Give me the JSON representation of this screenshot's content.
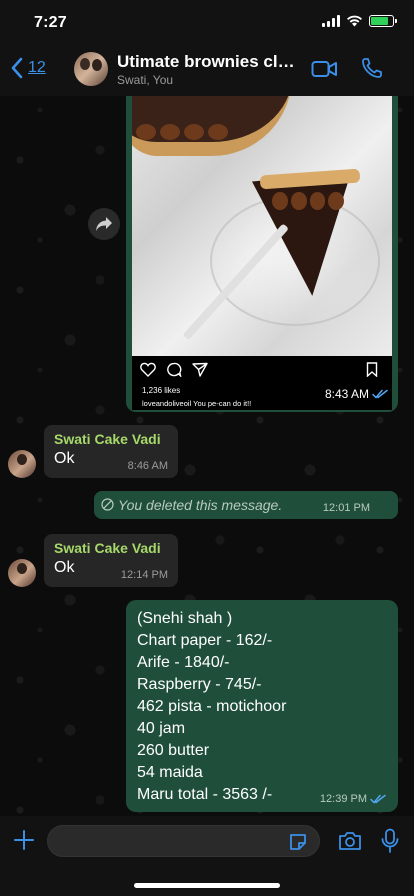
{
  "status_bar": {
    "time": "7:27",
    "battery_level": 0.8
  },
  "header": {
    "back_count": "12",
    "title": "Utimate brownies clas...",
    "subtitle": "Swati, You",
    "video_icon": "video-call-icon",
    "phone_icon": "phone-icon"
  },
  "image_message": {
    "likes": "1,236 likes",
    "caption": "loveandoliveoil You pe-can do it!!",
    "time": "8:43 AM"
  },
  "messages": [
    {
      "sender": "Swati Cake Vadi",
      "text": "Ok",
      "time": "8:46 AM"
    },
    {
      "sender": "Swati Cake Vadi",
      "text": "Ok",
      "time": "12:14 PM"
    }
  ],
  "deleted_message": {
    "text": "You deleted this message.",
    "time": "12:01 PM"
  },
  "outgoing_list": {
    "lines": [
      "(Snehi shah )",
      "Chart paper - 162/-",
      "Arife - 1840/-",
      "Raspberry - 745/-",
      "462 pista - motichoor",
      "40 jam",
      "260 butter",
      "54 maida",
      "Maru total - 3563 /-"
    ],
    "time": "12:39 PM"
  },
  "colors": {
    "accent_blue": "#3b8fe6",
    "outgoing_bubble": "#1f4f3a",
    "incoming_bubble": "#262626",
    "sender_name": "#a6d96a",
    "read_tick": "#53a8f5"
  }
}
